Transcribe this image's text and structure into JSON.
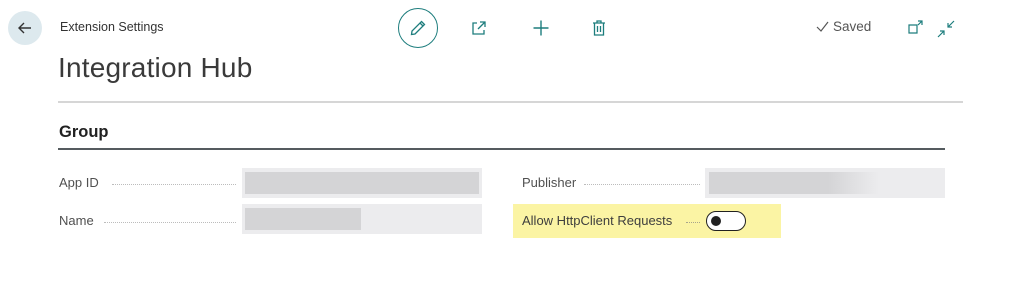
{
  "header": {
    "breadcrumb": "Extension Settings",
    "title": "Integration Hub",
    "status": "Saved"
  },
  "toolbar": {
    "edit_icon": "pencil-icon",
    "share_icon": "share-icon",
    "new_icon": "plus-icon",
    "delete_icon": "trash-icon",
    "popout_icon": "open-in-new-window-icon",
    "collapse_icon": "collapse-icon"
  },
  "group": {
    "title": "Group",
    "fields": {
      "app_id": {
        "label": "App ID",
        "value": ""
      },
      "name": {
        "label": "Name",
        "value": ""
      },
      "publisher": {
        "label": "Publisher",
        "value": ""
      },
      "allow_http": {
        "label": "Allow HttpClient Requests",
        "value": false
      }
    }
  },
  "colors": {
    "accent": "#1d7d7d",
    "highlight": "#fbf4a4",
    "back_button_bg": "#dde9ee"
  }
}
